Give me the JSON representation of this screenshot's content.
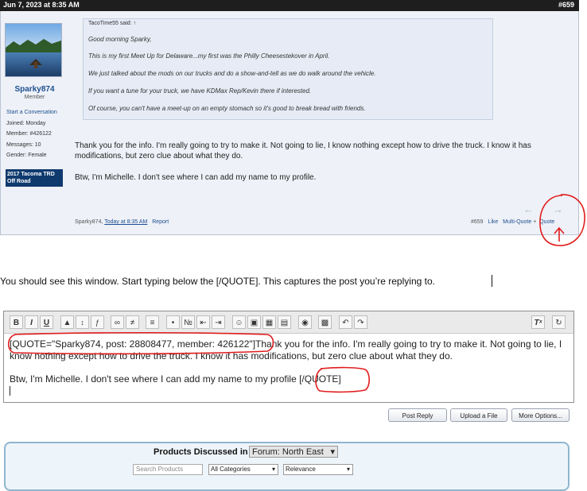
{
  "post": {
    "date": "Jun 7, 2023 at 8:35 AM",
    "post_number": "#659",
    "user": {
      "name": "Sparky874",
      "title": "Member",
      "start_conversation": "Start a Conversation",
      "joined": "Joined: Monday",
      "member": "Member: #426122",
      "messages": "Messages: 10",
      "gender": "Gender: Female",
      "badge": "2017 Tacoma TRD Off Road"
    },
    "quote": {
      "author": "TacoTime55 said: ↑",
      "lines": [
        "Good morning Sparky,",
        "This is my first Meet Up for Delaware...my first was the Philly Cheesestekover in April.",
        "We just talked about the mods on our trucks and do a show-and-tell as we do walk around the vehicle.",
        "If you want a tune for your truck, we have KDMax Rep/Kevin there if interested.",
        "Of course, you can't have a meet-up on an empty stomach so it's good to break bread with friends."
      ]
    },
    "reply_paragraph_1": "Thank you for the info. I'm really going to try to make it. Not going to lie, I know nothing except how to drive the truck. I know it has modifications, but zero clue about what they do.",
    "reply_paragraph_2": "Btw, I'm Michelle. I don't see where I can add my name to my profile.",
    "footer": {
      "author": "Sparky874,",
      "time": "Today at 8:35 AM",
      "report": "Report",
      "number": "#659",
      "like": "Like",
      "multi_quote": "Multi-Quote",
      "quote": "Quote"
    },
    "nav_icons": [
      "arrow-left-icon",
      "arrow-right-icon"
    ]
  },
  "instruction": "You should see this window.  Start typing below the [/QUOTE]. This captures the post you’re replying to.",
  "editor": {
    "toolbar_icons": [
      "bold",
      "italic",
      "underline",
      "text-color",
      "font-size",
      "font-family",
      "link",
      "unlink",
      "align",
      "bullet-list",
      "numbered-list",
      "outdent",
      "indent",
      "smilie",
      "image",
      "media",
      "code",
      "camera",
      "save",
      "undo",
      "redo",
      "clear-format",
      "toggle-bb"
    ],
    "toolbar_glyphs": {
      "bold": "B",
      "italic": "I",
      "underline": "U"
    },
    "quote_open": "[QUOTE=\"Sparky874, post: 28808477, member: 426122\"]",
    "line1_rest": "Thank you for the info.  I'm really going to try to make it.  Not going to lie, I know nothing except how to drive the truck.  I know it has modifications, but zero clue about what they do.",
    "line2": "Btw, I'm Michelle.  I don't see where I can add my name to my profile",
    "quote_close": "[/QUOTE]"
  },
  "buttons": {
    "post_reply": "Post Reply",
    "upload": "Upload a File",
    "more": "More Options..."
  },
  "products": {
    "title": "Products Discussed in",
    "forum_select": "Forum: North East",
    "search_placeholder": "Search Products",
    "category": "All Categories",
    "sort": "Relevance"
  },
  "colors": {
    "annotation": "#e11d1d",
    "header_bg": "#1e1e1e",
    "link": "#1d4f91",
    "badge_bg": "#0f3a6e"
  }
}
